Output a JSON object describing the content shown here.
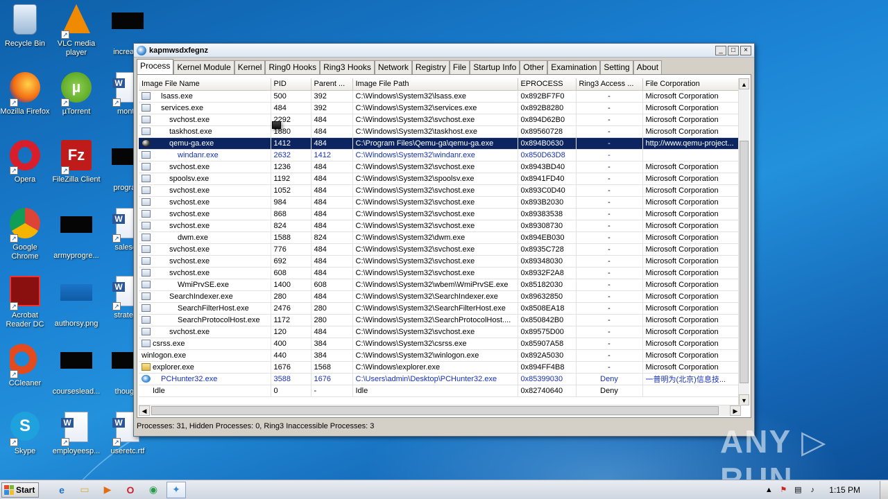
{
  "desktop_icons": [
    {
      "label": "Recycle Bin",
      "icon": "recycle-bin-icon"
    },
    {
      "label": "VLC media player",
      "icon": "vlc-icon"
    },
    {
      "label": "increase",
      "icon": "black-file-icon"
    },
    {
      "label": "Mozilla Firefox",
      "icon": "firefox-icon"
    },
    {
      "label": "µTorrent",
      "icon": "utorrent-icon"
    },
    {
      "label": "montv",
      "icon": "word-doc-icon"
    },
    {
      "label": "Opera",
      "icon": "opera-icon"
    },
    {
      "label": "FileZilla Client",
      "icon": "filezilla-icon"
    },
    {
      "label": "program",
      "icon": "black-file-icon"
    },
    {
      "label": "Google Chrome",
      "icon": "chrome-icon"
    },
    {
      "label": "armyprogre...",
      "icon": "black-file-icon"
    },
    {
      "label": "salesco",
      "icon": "word-doc-icon"
    },
    {
      "label": "Acrobat Reader DC",
      "icon": "acrobat-icon"
    },
    {
      "label": "authorsy.png",
      "icon": "image-file-icon"
    },
    {
      "label": "strategy",
      "icon": "word-doc-icon"
    },
    {
      "label": "CCleaner",
      "icon": "ccleaner-icon"
    },
    {
      "label": "courseslead...",
      "icon": "black-file-icon"
    },
    {
      "label": "thought",
      "icon": "black-file-icon"
    },
    {
      "label": "Skype",
      "icon": "skype-icon"
    },
    {
      "label": "employeesp...",
      "icon": "word-doc-icon"
    },
    {
      "label": "useretc.rtf",
      "icon": "word-doc-icon"
    }
  ],
  "window": {
    "title": "kapmwsdxfegnz",
    "buttons": {
      "minimize": "_",
      "maximize": "□",
      "close": "×"
    }
  },
  "tabs": [
    {
      "label": "Process",
      "active": true
    },
    {
      "label": "Kernel Module"
    },
    {
      "label": "Kernel"
    },
    {
      "label": "Ring0 Hooks"
    },
    {
      "label": "Ring3 Hooks"
    },
    {
      "label": "Network"
    },
    {
      "label": "Registry"
    },
    {
      "label": "File"
    },
    {
      "label": "Startup Info"
    },
    {
      "label": "Other"
    },
    {
      "label": "Examination"
    },
    {
      "label": "Setting"
    },
    {
      "label": "About"
    }
  ],
  "columns": [
    "Image File Name",
    "PID",
    "Parent ...",
    "Image File Path",
    "EPROCESS",
    "Ring3 Access ...",
    "File Corporation"
  ],
  "rows": [
    {
      "name": "lsass.exe",
      "indent": 1,
      "pid": "500",
      "ppid": "392",
      "path": "C:\\Windows\\System32\\lsass.exe",
      "eproc": "0x892BF7F0",
      "ring3": "-",
      "corp": "Microsoft Corporation",
      "icon": "app"
    },
    {
      "name": "services.exe",
      "indent": 1,
      "pid": "484",
      "ppid": "392",
      "path": "C:\\Windows\\System32\\services.exe",
      "eproc": "0x892B8280",
      "ring3": "-",
      "corp": "Microsoft Corporation",
      "icon": "app"
    },
    {
      "name": "svchost.exe",
      "indent": 2,
      "pid": "2292",
      "ppid": "484",
      "path": "C:\\Windows\\System32\\svchost.exe",
      "eproc": "0x894D62B0",
      "ring3": "-",
      "corp": "Microsoft Corporation",
      "icon": "app"
    },
    {
      "name": "taskhost.exe",
      "indent": 2,
      "pid": "1880",
      "ppid": "484",
      "path": "C:\\Windows\\System32\\taskhost.exe",
      "eproc": "0x89560728",
      "ring3": "-",
      "corp": "Microsoft Corporation",
      "icon": "app"
    },
    {
      "name": "qemu-ga.exe",
      "indent": 2,
      "pid": "1412",
      "ppid": "484",
      "path": "C:\\Program Files\\Qemu-ga\\qemu-ga.exe",
      "eproc": "0x894B0630",
      "ring3": "-",
      "corp": "http://www.qemu-project...",
      "icon": "ball",
      "style": "sel"
    },
    {
      "name": "windanr.exe",
      "indent": 3,
      "pid": "2632",
      "ppid": "1412",
      "path": "C:\\Windows\\System32\\windanr.exe",
      "eproc": "0x850D63D8",
      "ring3": "-",
      "corp": "",
      "icon": "app",
      "style": "blue"
    },
    {
      "name": "svchost.exe",
      "indent": 2,
      "pid": "1236",
      "ppid": "484",
      "path": "C:\\Windows\\System32\\svchost.exe",
      "eproc": "0x8943BD40",
      "ring3": "-",
      "corp": "Microsoft Corporation",
      "icon": "app"
    },
    {
      "name": "spoolsv.exe",
      "indent": 2,
      "pid": "1192",
      "ppid": "484",
      "path": "C:\\Windows\\System32\\spoolsv.exe",
      "eproc": "0x8941FD40",
      "ring3": "-",
      "corp": "Microsoft Corporation",
      "icon": "app"
    },
    {
      "name": "svchost.exe",
      "indent": 2,
      "pid": "1052",
      "ppid": "484",
      "path": "C:\\Windows\\System32\\svchost.exe",
      "eproc": "0x893C0D40",
      "ring3": "-",
      "corp": "Microsoft Corporation",
      "icon": "app"
    },
    {
      "name": "svchost.exe",
      "indent": 2,
      "pid": "984",
      "ppid": "484",
      "path": "C:\\Windows\\System32\\svchost.exe",
      "eproc": "0x893B2030",
      "ring3": "-",
      "corp": "Microsoft Corporation",
      "icon": "app"
    },
    {
      "name": "svchost.exe",
      "indent": 2,
      "pid": "868",
      "ppid": "484",
      "path": "C:\\Windows\\System32\\svchost.exe",
      "eproc": "0x89383538",
      "ring3": "-",
      "corp": "Microsoft Corporation",
      "icon": "app"
    },
    {
      "name": "svchost.exe",
      "indent": 2,
      "pid": "824",
      "ppid": "484",
      "path": "C:\\Windows\\System32\\svchost.exe",
      "eproc": "0x89308730",
      "ring3": "-",
      "corp": "Microsoft Corporation",
      "icon": "app"
    },
    {
      "name": "dwm.exe",
      "indent": 3,
      "pid": "1588",
      "ppid": "824",
      "path": "C:\\Windows\\System32\\dwm.exe",
      "eproc": "0x894EB030",
      "ring3": "-",
      "corp": "Microsoft Corporation",
      "icon": "app"
    },
    {
      "name": "svchost.exe",
      "indent": 2,
      "pid": "776",
      "ppid": "484",
      "path": "C:\\Windows\\System32\\svchost.exe",
      "eproc": "0x8935C728",
      "ring3": "-",
      "corp": "Microsoft Corporation",
      "icon": "app"
    },
    {
      "name": "svchost.exe",
      "indent": 2,
      "pid": "692",
      "ppid": "484",
      "path": "C:\\Windows\\System32\\svchost.exe",
      "eproc": "0x89348030",
      "ring3": "-",
      "corp": "Microsoft Corporation",
      "icon": "app"
    },
    {
      "name": "svchost.exe",
      "indent": 2,
      "pid": "608",
      "ppid": "484",
      "path": "C:\\Windows\\System32\\svchost.exe",
      "eproc": "0x8932F2A8",
      "ring3": "-",
      "corp": "Microsoft Corporation",
      "icon": "app"
    },
    {
      "name": "WmiPrvSE.exe",
      "indent": 3,
      "pid": "1400",
      "ppid": "608",
      "path": "C:\\Windows\\System32\\wbem\\WmiPrvSE.exe",
      "eproc": "0x85182030",
      "ring3": "-",
      "corp": "Microsoft Corporation",
      "icon": "app"
    },
    {
      "name": "SearchIndexer.exe",
      "indent": 2,
      "pid": "280",
      "ppid": "484",
      "path": "C:\\Windows\\System32\\SearchIndexer.exe",
      "eproc": "0x89632850",
      "ring3": "-",
      "corp": "Microsoft Corporation",
      "icon": "app"
    },
    {
      "name": "SearchFilterHost.exe",
      "indent": 3,
      "pid": "2476",
      "ppid": "280",
      "path": "C:\\Windows\\System32\\SearchFilterHost.exe",
      "eproc": "0x8508EA18",
      "ring3": "-",
      "corp": "Microsoft Corporation",
      "icon": "app"
    },
    {
      "name": "SearchProtocolHost.exe",
      "indent": 3,
      "pid": "1172",
      "ppid": "280",
      "path": "C:\\Windows\\System32\\SearchProtocolHost....",
      "eproc": "0x850842B0",
      "ring3": "-",
      "corp": "Microsoft Corporation",
      "icon": "app"
    },
    {
      "name": "svchost.exe",
      "indent": 2,
      "pid": "120",
      "ppid": "484",
      "path": "C:\\Windows\\System32\\svchost.exe",
      "eproc": "0x89575D00",
      "ring3": "-",
      "corp": "Microsoft Corporation",
      "icon": "app"
    },
    {
      "name": "csrss.exe",
      "indent": 0,
      "pid": "400",
      "ppid": "384",
      "path": "C:\\Windows\\System32\\csrss.exe",
      "eproc": "0x85907A58",
      "ring3": "-",
      "corp": "Microsoft Corporation",
      "icon": "app"
    },
    {
      "name": "winlogon.exe",
      "indent": 0,
      "pid": "440",
      "ppid": "384",
      "path": "C:\\Windows\\System32\\winlogon.exe",
      "eproc": "0x892A5030",
      "ring3": "-",
      "corp": "Microsoft Corporation",
      "icon": "win"
    },
    {
      "name": "explorer.exe",
      "indent": 0,
      "pid": "1676",
      "ppid": "1568",
      "path": "C:\\Windows\\explorer.exe",
      "eproc": "0x894FF4B8",
      "ring3": "-",
      "corp": "Microsoft Corporation",
      "icon": "folder"
    },
    {
      "name": "PCHunter32.exe",
      "indent": 1,
      "pid": "3588",
      "ppid": "1676",
      "path": "C:\\Users\\admin\\Desktop\\PCHunter32.exe",
      "eproc": "0x85399030",
      "ring3": "Deny",
      "corp": "一普明为(北京)信息技...",
      "icon": "pc",
      "style": "blue"
    },
    {
      "name": "Idle",
      "indent": 0,
      "pid": "0",
      "ppid": "-",
      "path": "Idle",
      "eproc": "0x82740640",
      "ring3": "Deny",
      "corp": "",
      "icon": "none"
    }
  ],
  "status": "Processes: 31, Hidden Processes: 0, Ring3 Inaccessible Processes: 3",
  "watermark": "ANY ▷ RUN",
  "taskbar": {
    "start_label": "Start",
    "apps": [
      {
        "name": "ie",
        "glyph": "e"
      },
      {
        "name": "explorer",
        "glyph": "▭"
      },
      {
        "name": "media-player",
        "glyph": "▶"
      },
      {
        "name": "opera",
        "glyph": "O"
      },
      {
        "name": "chrome",
        "glyph": "◉"
      },
      {
        "name": "pchunter",
        "glyph": "✦",
        "active": true
      }
    ],
    "clock": "1:15 PM"
  }
}
